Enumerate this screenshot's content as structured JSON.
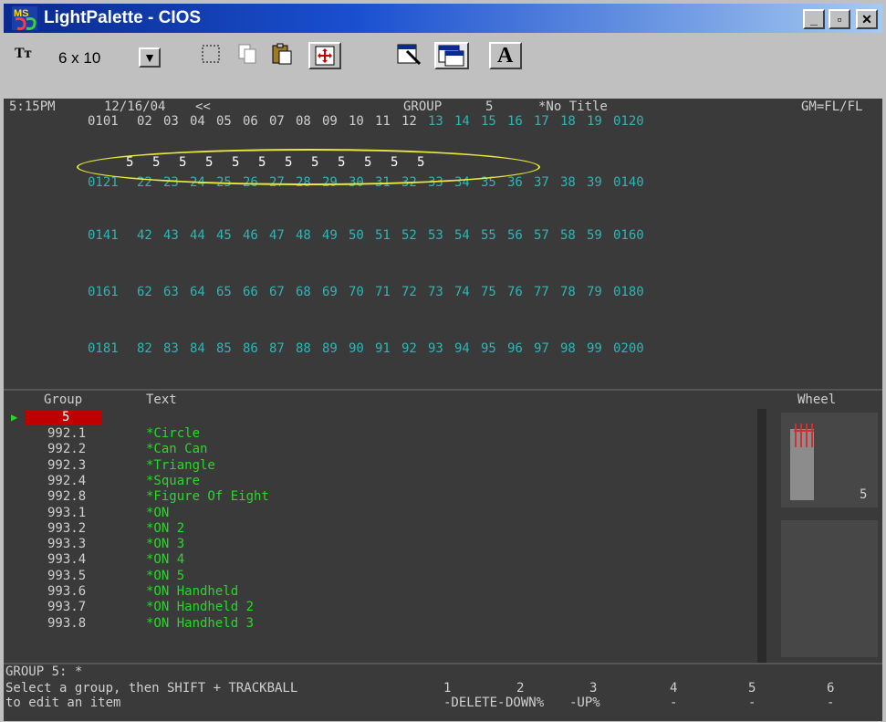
{
  "window": {
    "title": "LightPalette - CIOS",
    "logo_text": "MS",
    "controls": {
      "minimize": "_",
      "restore": "▫",
      "close": "✕"
    }
  },
  "toolbar": {
    "font_icon": "Tт",
    "font_size": "6 x 10",
    "icons": [
      "select-icon",
      "copy-icon",
      "paste-icon",
      "fit-icon",
      "properties-icon",
      "window-icon",
      "font-A-icon"
    ],
    "font_A": "A"
  },
  "status": {
    "time": "5:15PM",
    "date": "12/16/04",
    "arrows": "<<",
    "group_label": "GROUP",
    "group_num": "5",
    "title": "*No Title",
    "gm": "GM=FL/FL"
  },
  "channels": {
    "rows": [
      [
        "0101",
        "02",
        "03",
        "04",
        "05",
        "06",
        "07",
        "08",
        "09",
        "10",
        "11",
        "12",
        "13",
        "14",
        "15",
        "16",
        "17",
        "18",
        "19",
        "0120"
      ],
      [
        "0121",
        "22",
        "23",
        "24",
        "25",
        "26",
        "27",
        "28",
        "29",
        "30",
        "31",
        "32",
        "33",
        "34",
        "35",
        "36",
        "37",
        "38",
        "39",
        "0140"
      ],
      [
        "0141",
        "42",
        "43",
        "44",
        "45",
        "46",
        "47",
        "48",
        "49",
        "50",
        "51",
        "52",
        "53",
        "54",
        "55",
        "56",
        "57",
        "58",
        "59",
        "0160"
      ],
      [
        "0161",
        "62",
        "63",
        "64",
        "65",
        "66",
        "67",
        "68",
        "69",
        "70",
        "71",
        "72",
        "73",
        "74",
        "75",
        "76",
        "77",
        "78",
        "79",
        "0180"
      ],
      [
        "0181",
        "82",
        "83",
        "84",
        "85",
        "86",
        "87",
        "88",
        "89",
        "90",
        "91",
        "92",
        "93",
        "94",
        "95",
        "96",
        "97",
        "98",
        "99",
        "0200"
      ]
    ],
    "levels_row1": [
      "5",
      "5",
      "5",
      "5",
      "5",
      "5",
      "5",
      "5",
      "5",
      "5",
      "5",
      "5"
    ]
  },
  "group_list": {
    "header_group": "Group",
    "header_text": "Text",
    "header_wheel": "Wheel",
    "selected_group": "5",
    "items": [
      {
        "group": "992.1",
        "text": "*Circle"
      },
      {
        "group": "992.2",
        "text": "*Can Can"
      },
      {
        "group": "992.3",
        "text": "*Triangle"
      },
      {
        "group": "992.4",
        "text": "*Square"
      },
      {
        "group": "992.8",
        "text": "*Figure Of Eight"
      },
      {
        "group": "993.1",
        "text": "*ON"
      },
      {
        "group": "993.2",
        "text": "*ON 2"
      },
      {
        "group": "993.3",
        "text": "*ON 3"
      },
      {
        "group": "993.4",
        "text": "*ON 4"
      },
      {
        "group": "993.5",
        "text": "*ON 5"
      },
      {
        "group": "993.6",
        "text": "*ON Handheld"
      },
      {
        "group": "993.7",
        "text": "*ON Handheld 2"
      },
      {
        "group": "993.8",
        "text": "*ON Handheld 3"
      }
    ],
    "wheel_value": "5"
  },
  "command": {
    "line": "GROUP 5: *",
    "prompt1": "Select a group, then SHIFT + TRACKBALL",
    "prompt2": "to edit an item",
    "softkeys_nums": [
      "1",
      "2",
      "3",
      "4",
      "5",
      "6"
    ],
    "softkeys_labels": [
      "-DELETE-",
      "DOWN%",
      "-UP%",
      "-",
      "-",
      "-"
    ]
  }
}
